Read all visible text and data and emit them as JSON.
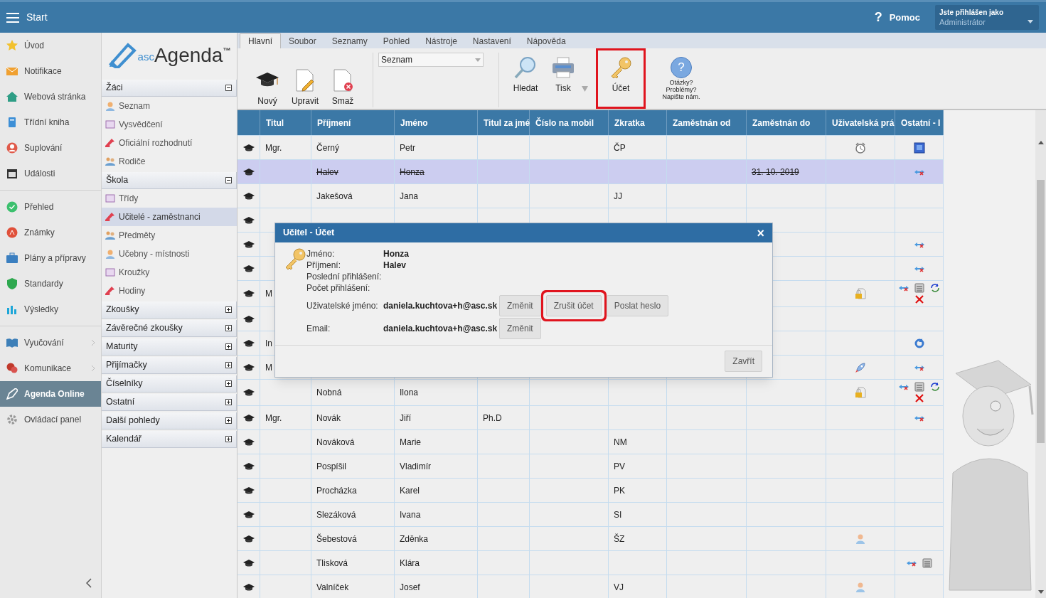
{
  "top_bar": {
    "title": "Start",
    "help": {
      "icon_text": "?",
      "label": "Pomoc"
    },
    "user": {
      "caption": "Jste přihlášen jako",
      "role": "Administrátor"
    }
  },
  "nav_groups": [
    [
      {
        "label": "Úvod",
        "selected": false,
        "has_submenu": false
      },
      {
        "label": "Notifikace",
        "selected": false,
        "has_submenu": false
      },
      {
        "label": "Webová stránka",
        "selected": false,
        "has_submenu": false
      },
      {
        "label": "Třídní kniha",
        "selected": false,
        "has_submenu": false
      },
      {
        "label": "Suplování",
        "selected": false,
        "has_submenu": false
      },
      {
        "label": "Události",
        "selected": false,
        "has_submenu": false
      }
    ],
    [
      {
        "label": "Přehled",
        "selected": false,
        "has_submenu": false
      },
      {
        "label": "Známky",
        "selected": false,
        "has_submenu": false
      },
      {
        "label": "Plány a přípravy",
        "selected": false,
        "has_submenu": false
      },
      {
        "label": "Standardy",
        "selected": false,
        "has_submenu": false
      },
      {
        "label": "Výsledky",
        "selected": false,
        "has_submenu": false
      }
    ],
    [
      {
        "label": "Vyučování",
        "selected": false,
        "has_submenu": true
      },
      {
        "label": "Komunikace",
        "selected": false,
        "has_submenu": true
      },
      {
        "label": "Agenda Online",
        "selected": true,
        "has_submenu": false
      },
      {
        "label": "Ovládací panel",
        "selected": false,
        "has_submenu": false
      }
    ]
  ],
  "logo": {
    "prefix": "asc",
    "name": "Agenda",
    "mark": "™"
  },
  "sections": [
    {
      "label": "Žáci",
      "expanded": true,
      "items": [
        {
          "label": "Seznam",
          "selected": false
        },
        {
          "label": "Vysvědčení",
          "selected": false
        },
        {
          "label": "Oficiální rozhodnutí",
          "selected": false
        },
        {
          "label": "Rodiče",
          "selected": false
        }
      ]
    },
    {
      "label": "Škola",
      "expanded": true,
      "items": [
        {
          "label": "Třídy",
          "selected": false
        },
        {
          "label": "Učitelé - zaměstnanci",
          "selected": true
        },
        {
          "label": "Předměty",
          "selected": false
        },
        {
          "label": "Učebny - místnosti",
          "selected": false
        },
        {
          "label": "Kroužky",
          "selected": false
        },
        {
          "label": "Hodiny",
          "selected": false
        }
      ]
    },
    {
      "label": "Zkoušky",
      "expanded": false
    },
    {
      "label": "Závěrečné zkoušky",
      "expanded": false
    },
    {
      "label": "Maturity",
      "expanded": false
    },
    {
      "label": "Přijímačky",
      "expanded": false
    },
    {
      "label": "Číselníky",
      "expanded": false
    },
    {
      "label": "Ostatní",
      "expanded": false
    },
    {
      "label": "Další pohledy",
      "expanded": false
    },
    {
      "label": "Kalendář",
      "expanded": false
    }
  ],
  "ribbon_tabs": [
    {
      "label": "Hlavní",
      "selected": true
    },
    {
      "label": "Soubor",
      "selected": false
    },
    {
      "label": "Seznamy",
      "selected": false
    },
    {
      "label": "Pohled",
      "selected": false
    },
    {
      "label": "Nástroje",
      "selected": false
    },
    {
      "label": "Nastavení",
      "selected": false
    },
    {
      "label": "Nápověda",
      "selected": false
    }
  ],
  "ribbon": {
    "buttons_left": [
      {
        "label": "Nový",
        "kind": "cap"
      },
      {
        "label": "Upravit",
        "kind": "edit"
      },
      {
        "label": "Smaž",
        "kind": "delete"
      }
    ],
    "view_select": {
      "value": "Seznam"
    },
    "buttons_right": [
      {
        "label": "Hledat",
        "kind": "search",
        "has_menu": false,
        "highlighted": false
      },
      {
        "label": "Tisk",
        "kind": "print",
        "has_menu": true,
        "highlighted": false
      },
      {
        "label": "Účet",
        "kind": "key",
        "has_menu": false,
        "highlighted": true
      }
    ],
    "help": {
      "icon_text": "?",
      "lines": [
        "Otázky?",
        "Problémy?",
        "Napište nám."
      ]
    }
  },
  "table": {
    "columns": [
      "Titul",
      "Příjmení",
      "Jméno",
      "Titul za jmé",
      "Číslo na mobil",
      "Zkratka",
      "Zaměstnán od",
      "Zaměstnán do",
      "Uživatelská prá",
      "Ostatní - I"
    ],
    "rows": [
      {
        "selected": false,
        "struck": false,
        "cells": [
          "Mgr.",
          "Černý",
          "Petr",
          "",
          "",
          "ČP",
          "",
          ""
        ],
        "rights_icons": [
          {
            "kind": "alarm"
          }
        ],
        "other_icons": [
          {
            "kind": "monitor"
          }
        ]
      },
      {
        "selected": true,
        "struck": true,
        "cells": [
          "",
          "Halev",
          "Honza",
          "",
          "",
          "",
          "",
          "31. 10. 2019"
        ],
        "rights_icons": [],
        "other_icons": [
          {
            "kind": "link-x"
          }
        ]
      },
      {
        "selected": false,
        "struck": false,
        "cells": [
          "",
          "Jakešová",
          "Jana",
          "",
          "",
          "JJ",
          "",
          ""
        ],
        "rights_icons": [],
        "other_icons": []
      },
      {
        "selected": false,
        "cells": [
          "",
          "",
          "",
          "",
          "",
          "",
          "",
          ""
        ],
        "rights_icons": [],
        "other_icons": []
      },
      {
        "selected": false,
        "cells": [
          "",
          "",
          "",
          "",
          "",
          "",
          "",
          ""
        ],
        "rights_icons": [],
        "other_icons": [
          {
            "kind": "link-x"
          }
        ]
      },
      {
        "selected": false,
        "cells": [
          "",
          "",
          "",
          "",
          "",
          "",
          "",
          ""
        ],
        "rights_icons": [],
        "other_icons": [
          {
            "kind": "link-x"
          }
        ]
      },
      {
        "selected": false,
        "struck": false,
        "cells": [
          "M",
          "",
          "",
          "",
          "",
          "",
          "",
          ""
        ],
        "rights_icons": [
          {
            "kind": "lock"
          }
        ],
        "other_icons": [
          {
            "kind": "link-x"
          },
          {
            "kind": "printer"
          },
          {
            "kind": "sync"
          },
          {
            "kind": "x"
          }
        ]
      },
      {
        "selected": false,
        "cells": [
          "",
          "",
          "",
          "",
          "",
          "",
          "",
          ""
        ],
        "rights_icons": [],
        "other_icons": []
      },
      {
        "selected": false,
        "struck": false,
        "cells": [
          "In",
          "",
          "",
          "",
          "",
          "",
          "",
          ""
        ],
        "rights_icons": [],
        "other_icons": [
          {
            "kind": "refresh"
          }
        ]
      },
      {
        "selected": false,
        "struck": false,
        "cells": [
          "M",
          "",
          "",
          "",
          "",
          "",
          "",
          ""
        ],
        "rights_icons": [
          {
            "kind": "rocket"
          }
        ],
        "other_icons": [
          {
            "kind": "link-x"
          }
        ]
      },
      {
        "selected": false,
        "struck": false,
        "cells": [
          "",
          "Nobná",
          "Ilona",
          "",
          "",
          "",
          "",
          ""
        ],
        "rights_icons": [
          {
            "kind": "lock"
          }
        ],
        "other_icons": [
          {
            "kind": "link-x"
          },
          {
            "kind": "printer"
          },
          {
            "kind": "sync"
          },
          {
            "kind": "x"
          }
        ]
      },
      {
        "selected": false,
        "struck": false,
        "cells": [
          "Mgr.",
          "Novák",
          "Jiří",
          "Ph.D",
          "",
          "",
          "",
          ""
        ],
        "rights_icons": [],
        "other_icons": [
          {
            "kind": "link-x"
          }
        ]
      },
      {
        "selected": false,
        "struck": false,
        "cells": [
          "",
          "Nováková",
          "Marie",
          "",
          "",
          "NM",
          "",
          ""
        ],
        "rights_icons": [],
        "other_icons": []
      },
      {
        "selected": false,
        "struck": false,
        "cells": [
          "",
          "Pospíšil",
          "Vladimír",
          "",
          "",
          "PV",
          "",
          ""
        ],
        "rights_icons": [],
        "other_icons": []
      },
      {
        "selected": false,
        "struck": false,
        "cells": [
          "",
          "Procházka",
          "Karel",
          "",
          "",
          "PK",
          "",
          ""
        ],
        "rights_icons": [],
        "other_icons": []
      },
      {
        "selected": false,
        "struck": false,
        "cells": [
          "",
          "Slezáková",
          "Ivana",
          "",
          "",
          "SI",
          "",
          ""
        ],
        "rights_icons": [],
        "other_icons": []
      },
      {
        "selected": false,
        "struck": false,
        "cells": [
          "",
          "Šebestová",
          "Zděnka",
          "",
          "",
          "ŠZ",
          "",
          ""
        ],
        "rights_icons": [
          {
            "kind": "person"
          }
        ],
        "other_icons": []
      },
      {
        "selected": false,
        "struck": false,
        "cells": [
          "",
          "Tlisková",
          "Klára",
          "",
          "",
          "",
          "",
          ""
        ],
        "rights_icons": [],
        "other_icons": [
          {
            "kind": "link-x"
          },
          {
            "kind": "printer"
          }
        ]
      },
      {
        "selected": false,
        "struck": false,
        "cells": [
          "",
          "Valníček",
          "Josef",
          "",
          "",
          "VJ",
          "",
          ""
        ],
        "rights_icons": [
          {
            "kind": "person"
          }
        ],
        "other_icons": []
      }
    ]
  },
  "dialog": {
    "title": "Učitel - Účet",
    "close": "×",
    "fields": [
      {
        "label": "Jméno:",
        "value": "Honza"
      },
      {
        "label": "Příjmení:",
        "value": "Halev"
      },
      {
        "label": "Poslední přihlášení:"
      },
      {
        "label": "Počet přihlášení:"
      }
    ],
    "account_rows": [
      {
        "label": "Uživatelské jméno:",
        "value": "daniela.kuchtova+h@asc.sk",
        "buttons": [
          {
            "label": "Změnit",
            "highlighted": false
          },
          {
            "label": "Zrušit účet",
            "highlighted": true
          },
          {
            "label": "Poslat heslo",
            "highlighted": false
          }
        ]
      },
      {
        "label": "Email:",
        "value": "daniela.kuchtova+h@asc.sk",
        "buttons": [
          {
            "label": "Změnit",
            "highlighted": false
          }
        ]
      }
    ],
    "close_button": "Zavřít"
  }
}
